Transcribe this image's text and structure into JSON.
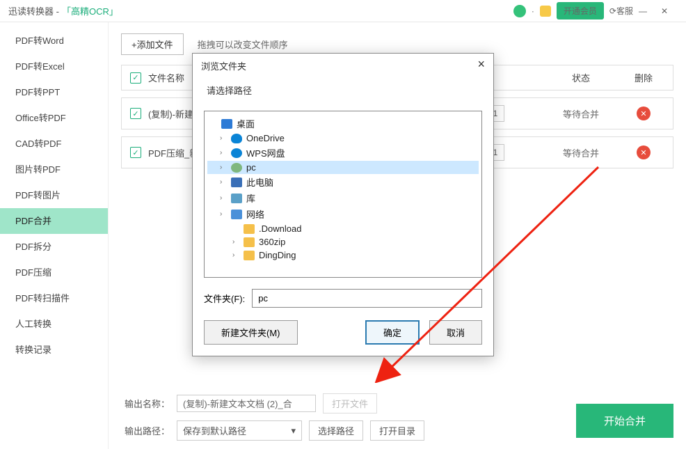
{
  "titlebar": {
    "app": "迅读转换器 -",
    "ocr": "「高精OCR」",
    "vip": "开通会员",
    "kefu": "客服"
  },
  "sidebar": {
    "items": [
      "PDF转Word",
      "PDF转Excel",
      "PDF转PPT",
      "Office转PDF",
      "CAD转PDF",
      "图片转PDF",
      "PDF转图片",
      "PDF合并",
      "PDF拆分",
      "PDF压缩",
      "PDF转扫描件",
      "人工转换",
      "转换记录"
    ],
    "active_index": 7
  },
  "main": {
    "add_btn": "+添加文件",
    "drag_hint": "拖拽可以改变文件顺序",
    "header": {
      "name": "文件名称",
      "status": "状态",
      "delete": "删除"
    },
    "rows": [
      {
        "name": "(复制)-新建",
        "num": "1",
        "status": "等待合并"
      },
      {
        "name": "PDF压缩_新",
        "num": "1",
        "status": "等待合并"
      }
    ]
  },
  "bottom": {
    "out_name_lbl": "输出名称：",
    "out_name_val": "(复制)-新建文本文档 (2)_合",
    "open_file_btn": "打开文件",
    "out_path_lbl": "输出路径：",
    "out_path_val": "保存到默认路径",
    "select_path_btn": "选择路径",
    "open_dir_btn": "打开目录",
    "start_btn": "开始合并"
  },
  "dialog": {
    "title": "浏览文件夹",
    "hint": "请选择路径",
    "tree": [
      {
        "label": "桌面",
        "icon": "ico-desktop",
        "indent": 0,
        "caret": ""
      },
      {
        "label": "OneDrive",
        "icon": "ico-onedrive",
        "indent": 1,
        "caret": "›"
      },
      {
        "label": "WPS网盘",
        "icon": "ico-wps",
        "indent": 1,
        "caret": "›"
      },
      {
        "label": "pc",
        "icon": "ico-pc",
        "indent": 1,
        "caret": "›",
        "selected": true
      },
      {
        "label": "此电脑",
        "icon": "ico-thispc",
        "indent": 1,
        "caret": "›"
      },
      {
        "label": "库",
        "icon": "ico-lib",
        "indent": 1,
        "caret": "›"
      },
      {
        "label": "网络",
        "icon": "ico-net",
        "indent": 1,
        "caret": "›"
      },
      {
        "label": ".Download",
        "icon": "ico-folder",
        "indent": 2,
        "caret": ""
      },
      {
        "label": "360zip",
        "icon": "ico-folder",
        "indent": 2,
        "caret": "›"
      },
      {
        "label": "DingDing",
        "icon": "ico-folder",
        "indent": 2,
        "caret": "›"
      }
    ],
    "folder_lbl": "文件夹(F):",
    "folder_val": "pc",
    "new_folder": "新建文件夹(M)",
    "ok": "确定",
    "cancel": "取消"
  }
}
